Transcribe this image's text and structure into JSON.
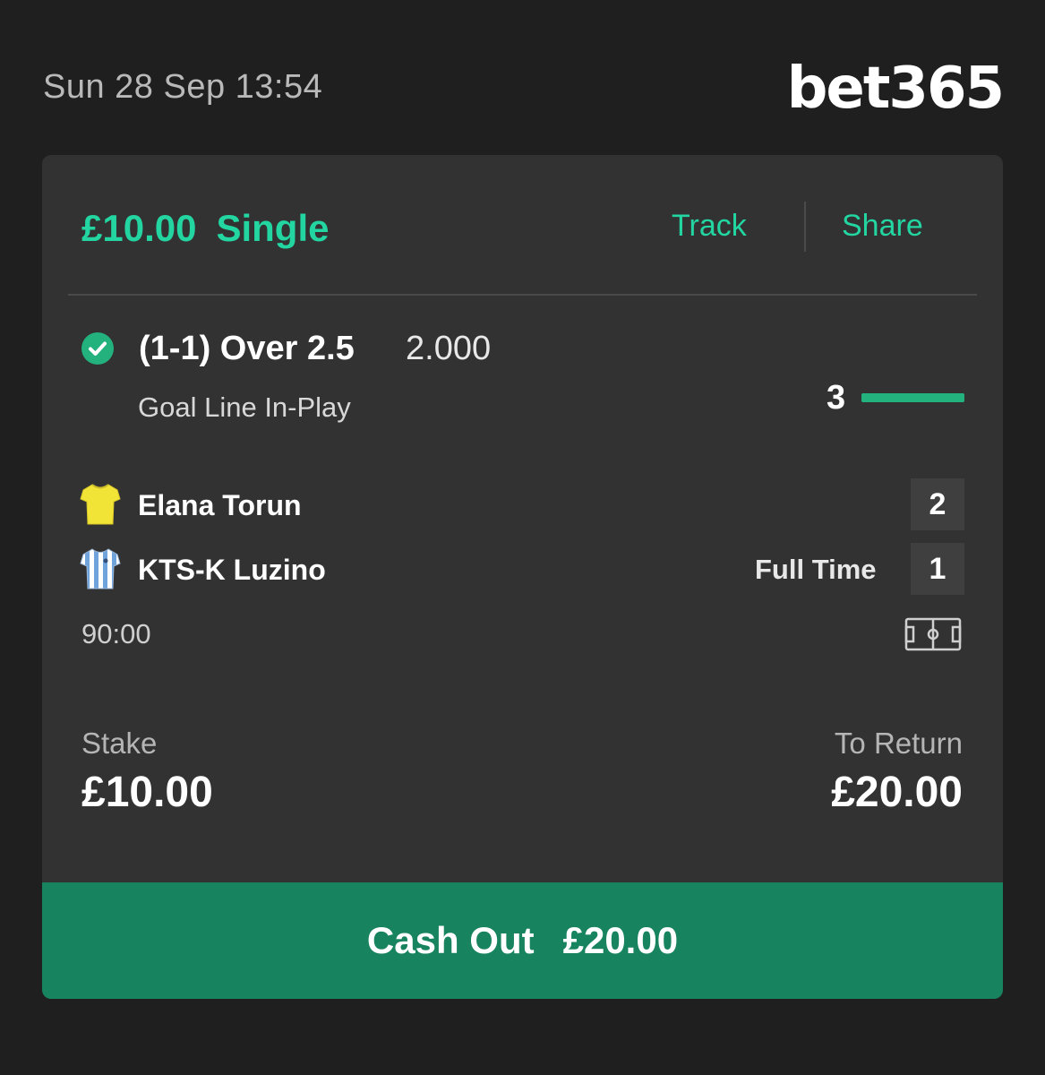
{
  "status_bar": {
    "datetime": "Sun 28 Sep 13:54"
  },
  "brand": {
    "logo_text": "bet365"
  },
  "bet": {
    "stake_header": "£10.00",
    "type": "Single",
    "track_label": "Track",
    "share_label": "Share",
    "status_icon": "check-circle-icon",
    "selection": "(1-1) Over 2.5",
    "odds": "2.000",
    "market": "Goal Line In-Play",
    "goals_total": "3",
    "goals_progress": 1.0
  },
  "match": {
    "home_team": {
      "name": "Elana Torun",
      "score": "2",
      "shirt_icon": "yellow-shirt-icon"
    },
    "away_team": {
      "name": "KTS-K Luzino",
      "score": "1",
      "shirt_icon": "blue-white-striped-shirt-icon"
    },
    "status": "Full Time",
    "clock": "90:00",
    "pitch_icon": "football-pitch-icon"
  },
  "summary": {
    "stake_label": "Stake",
    "stake_value": "£10.00",
    "return_label": "To Return",
    "return_value": "£20.00"
  },
  "cashout": {
    "label": "Cash Out",
    "amount": "£20.00"
  },
  "colors": {
    "accent": "#23d5a1",
    "cashout_bg": "#17835f",
    "card_bg": "#323232",
    "page_bg": "#1f1f1f"
  }
}
